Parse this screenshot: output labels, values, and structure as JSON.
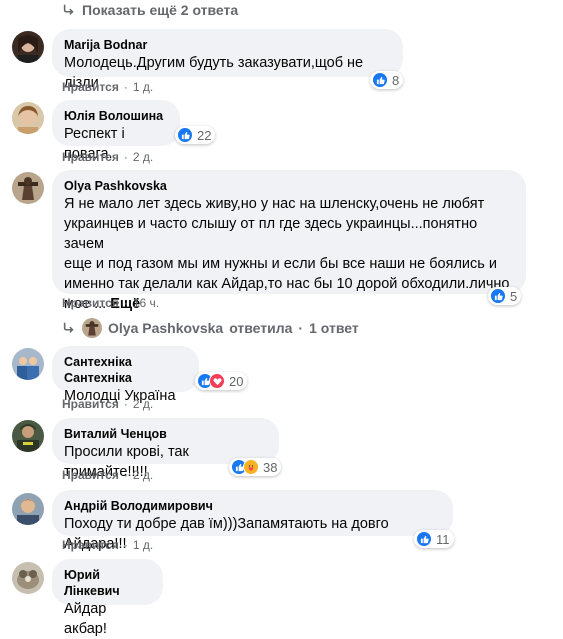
{
  "colors": {
    "like": "#1877f2",
    "love": "#f33e58",
    "care": "#f7b125",
    "bubble": "#f0f2f5",
    "meta": "#65676b"
  },
  "more_replies": "Показать ещё 2 ответа",
  "comments": [
    {
      "author": "Marija Bodnar",
      "lines": [
        "Молодець.Другим будуть заказувати,щоб не лізли"
      ],
      "like": "Нравится",
      "reply": "Ответить",
      "time": "1 д.",
      "reactions": [
        "like"
      ],
      "count": "8"
    },
    {
      "author": "Юлія Волошина",
      "lines": [
        "Респект і повага."
      ],
      "like": "Нравится",
      "reply": "Ответить",
      "time": "2 д.",
      "reactions": [
        "like"
      ],
      "count": "22"
    },
    {
      "author": "Olya Pashkovska",
      "lines": [
        "Я не мало лет здесь живу,но у нас на шленску,очень не любят",
        "украинцев и часто слышу от пл где здесь украинцы...понятно зачем",
        "еще и под газом мы им нужны и если бы все наши не боялись и",
        "именно так делали как Айдар,то нас бы 10 дорой обходили.лично",
        "мое ..."
      ],
      "see_more": "Ещё",
      "like": "Нравится",
      "reply": "Ответить",
      "time": "16 ч.",
      "reactions": [
        "like"
      ],
      "count": "5"
    },
    {
      "author": "Сантехніка Сантехніка",
      "lines": [
        "Молодці Україна"
      ],
      "like": "Нравится",
      "reply": "Ответить",
      "time": "2 д.",
      "reactions": [
        "like",
        "love"
      ],
      "count": "20"
    },
    {
      "author": "Виталий Ченцов",
      "lines": [
        "Просили крові, так тримайте!!!!!"
      ],
      "like": "Нравится",
      "reply": "Ответить",
      "time": "2 д.",
      "reactions": [
        "like",
        "care"
      ],
      "count": "38"
    },
    {
      "author": "Андрій Володимирович",
      "lines": [
        "Походу ти добре дав їм)))Запамятають на довго Айдара!!!"
      ],
      "like": "Нравится",
      "reply": "Ответить",
      "time": "1 д.",
      "reactions": [
        "like"
      ],
      "count": "11"
    },
    {
      "author": "Юрий Лінкевич",
      "lines": [
        "Айдар акбар!"
      ]
    }
  ],
  "reply_thread": {
    "name": "Olya Pashkovska",
    "action": "ответила",
    "dot": "·",
    "replies": "1 ответ"
  },
  "icons": {
    "reply_arrow": "reply-arrow-icon",
    "like": "like-icon",
    "love": "love-icon",
    "care": "care-icon"
  }
}
